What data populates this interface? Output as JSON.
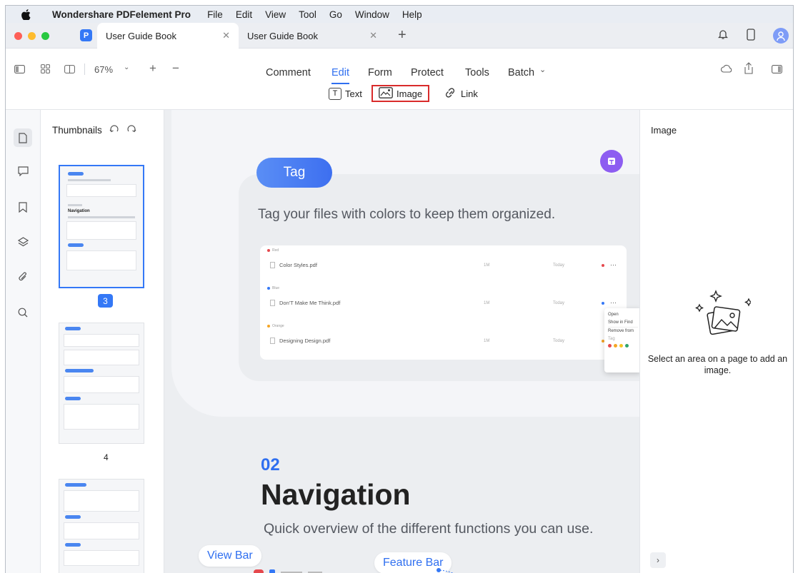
{
  "menubar": {
    "app_name": "Wondershare PDFelement Pro",
    "items": [
      "File",
      "Edit",
      "View",
      "Tool",
      "Go",
      "Window",
      "Help"
    ]
  },
  "tabs": [
    {
      "label": "User Guide Book",
      "active": true
    },
    {
      "label": "User Guide Book",
      "active": false
    }
  ],
  "toolbar": {
    "zoom": "67%",
    "nav": [
      "Comment",
      "Edit",
      "Form",
      "Protect",
      "Tools",
      "Batch"
    ],
    "active_nav": "Edit",
    "sub_tools": [
      "Text",
      "Image",
      "Link"
    ],
    "highlighted_tool": "Image"
  },
  "thumbnails": {
    "title": "Thumbnails",
    "pages": [
      "3",
      "4"
    ],
    "selected_page": "3"
  },
  "document": {
    "tag_label": "Tag",
    "tag_description": "Tag your files with colors to keep them organized.",
    "files": [
      {
        "category": "Red",
        "name": "Color Styles.pdf",
        "size": "1M",
        "date": "Today",
        "color": "#e5484d"
      },
      {
        "category": "Blue",
        "name": "Don'T Make Me Think.pdf",
        "size": "1M",
        "date": "Today",
        "color": "#3478f6"
      },
      {
        "category": "Orange",
        "name": "Designing Design.pdf",
        "size": "1M",
        "date": "Today",
        "color": "#f5a524"
      }
    ],
    "context_menu": [
      "Open",
      "Show in Find",
      "Remove from",
      "Tag"
    ],
    "section_number": "02",
    "section_title": "Navigation",
    "section_desc": "Quick overview of the different functions you can use.",
    "callouts": [
      "View Bar",
      "Feature Bar"
    ]
  },
  "right_panel": {
    "title": "Image",
    "message": "Select an area on a page to add an image."
  },
  "colors": {
    "accent": "#2f6ff0",
    "highlight_border": "#d92b2b",
    "purple": "#8d5df1"
  }
}
